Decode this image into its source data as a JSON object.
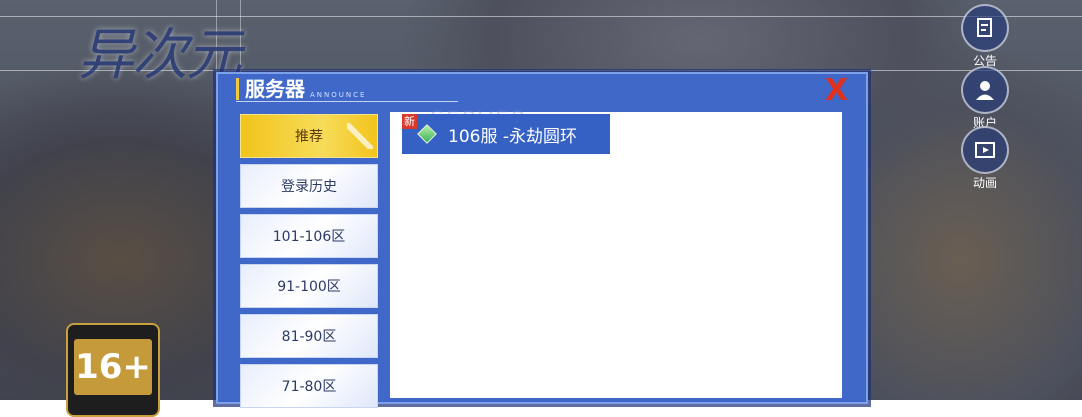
{
  "logo_text": "异次元",
  "rating": "16+",
  "side_buttons": [
    {
      "label": "公告",
      "icon": "notice-icon"
    },
    {
      "label": "账户",
      "icon": "account-icon"
    },
    {
      "label": "动画",
      "icon": "animation-icon"
    }
  ],
  "panel": {
    "title": "服务器",
    "subtitle": "ANNOUNCE",
    "watermark": "SERVER",
    "close": "X"
  },
  "tabs": [
    {
      "label": "推荐",
      "active": true
    },
    {
      "label": "登录历史",
      "active": false
    },
    {
      "label": "101-106区",
      "active": false
    },
    {
      "label": "91-100区",
      "active": false
    },
    {
      "label": "81-90区",
      "active": false
    },
    {
      "label": "71-80区",
      "active": false
    }
  ],
  "servers": [
    {
      "name": "106服 -永劫圆环",
      "tag": "新"
    }
  ],
  "colors": {
    "accent": "#f2c41c",
    "panel": "#3f68c8",
    "close": "#e0301e",
    "server": "#3560c4"
  }
}
